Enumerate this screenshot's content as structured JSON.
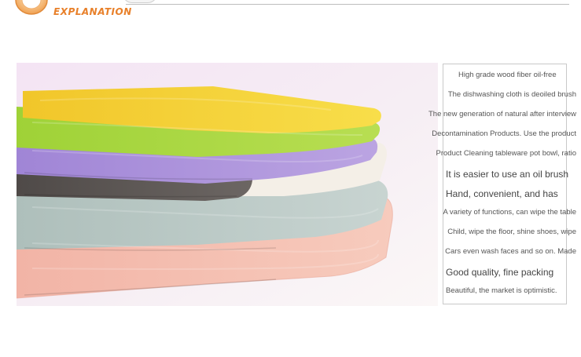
{
  "header": {
    "title": "EXPLANATION"
  },
  "product_text": {
    "lines": [
      "High grade wood fiber oil-free",
      "The dishwashing cloth is deoiled brush",
      "The new generation of natural after interview",
      "Decontamination Products. Use the product",
      "Product Cleaning tableware pot bowl, ratio",
      "It is easier to use an oil brush",
      "Hand, convenient, and has",
      "A variety of functions, can wipe the table",
      "Child, wipe the floor, shine shoes, wipe",
      "Cars even wash faces and so on. Made",
      "Good quality, fine packing",
      "Beautiful, the market is optimistic."
    ]
  },
  "colors": {
    "accent": "#e8802a",
    "cloth_yellow": "#f3d23a",
    "cloth_green": "#a6d63a",
    "cloth_purple": "#a98ad8",
    "cloth_white": "#f4efe7",
    "cloth_gray": "#5e5855",
    "cloth_mint": "#b9c8c4",
    "cloth_pink": "#f0b7a8"
  }
}
